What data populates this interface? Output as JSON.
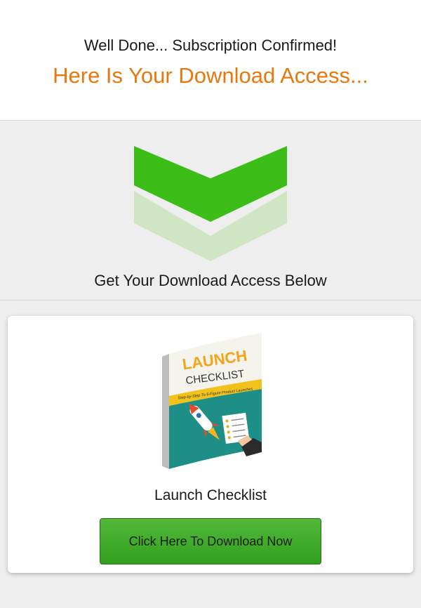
{
  "header": {
    "subtitle": "Well Done... Subscription Confirmed!",
    "headline": "Here Is Your Download Access..."
  },
  "band": {
    "icon": "double-chevron-down-icon",
    "caption": "Get Your Download Access Below"
  },
  "product": {
    "cover_title_line1": "LAUNCH",
    "cover_title_line2": "CHECKLIST",
    "cover_tagline": "Step-by-Step To 6-Figure Product Launches",
    "title": "Launch Checklist",
    "button_label": "Click Here To Download Now"
  },
  "colors": {
    "accent_orange": "#e8780e",
    "chevron_green": "#3cbd18",
    "chevron_light": "#cfe5c4",
    "button_green": "#3faa26"
  }
}
